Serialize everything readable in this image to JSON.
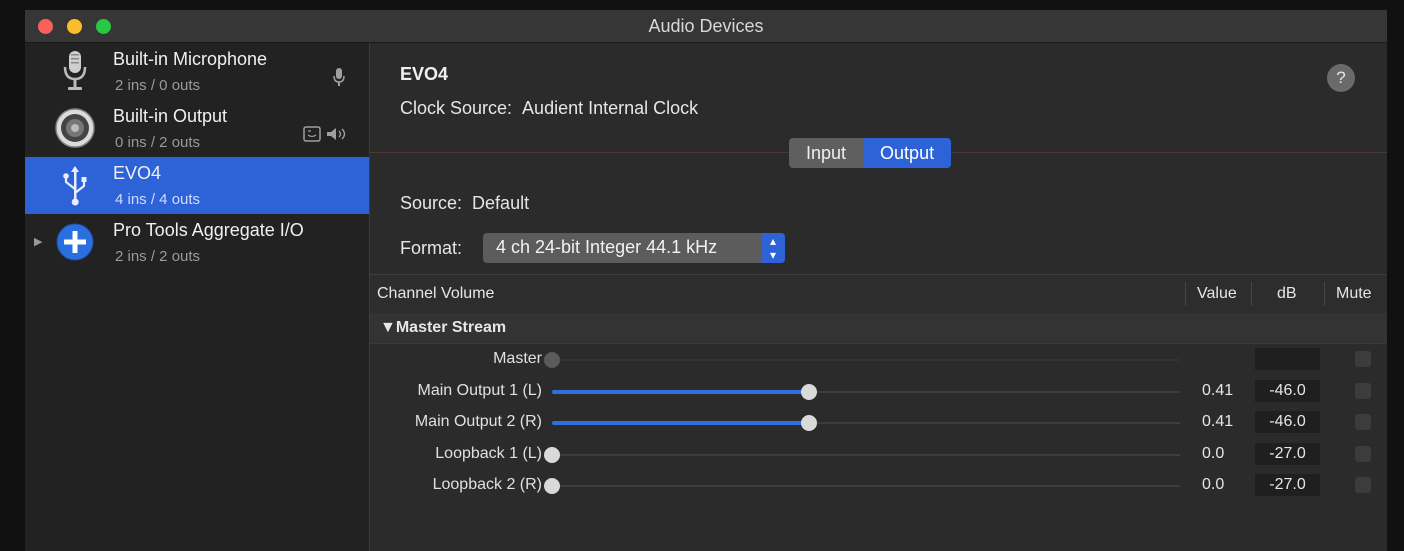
{
  "window": {
    "title": "Audio Devices"
  },
  "devices": [
    {
      "name": "Built-in Microphone",
      "io": "2 ins / 0 outs",
      "icon": "microphone-icon",
      "trailing": "mic-input-icon"
    },
    {
      "name": "Built-in Output",
      "io": "0 ins / 2 outs",
      "icon": "speaker-icon",
      "trailing": "finder-speaker-icons"
    },
    {
      "name": "EVO4",
      "io": "4 ins / 4 outs",
      "icon": "usb-icon",
      "selected": true
    },
    {
      "name": "Pro Tools Aggregate I/O",
      "io": "2 ins / 2 outs",
      "icon": "aggregate-plus-icon",
      "collapsed": true
    }
  ],
  "detail": {
    "device_name": "EVO4",
    "help": "?",
    "clock_label": "Clock Source:",
    "clock_value": "Audient Internal Clock",
    "tabs": {
      "input": "Input",
      "output": "Output",
      "active": "output"
    },
    "source_label": "Source:",
    "source_value": "Default",
    "format_label": "Format:",
    "format_value": "4 ch 24-bit Integer 44.1 kHz"
  },
  "table": {
    "headers": {
      "channel": "Channel Volume",
      "value": "Value",
      "db": "dB",
      "mute": "Mute"
    },
    "stream_label": "Master Stream",
    "rows": [
      {
        "label": "Master",
        "level": 0.0,
        "value": "",
        "db": "",
        "enabled": false
      },
      {
        "label": "Main Output 1 (L)",
        "level": 0.41,
        "value": "0.41",
        "db": "-46.0",
        "enabled": true
      },
      {
        "label": "Main Output 2 (R)",
        "level": 0.41,
        "value": "0.41",
        "db": "-46.0",
        "enabled": true
      },
      {
        "label": "Loopback 1 (L)",
        "level": 0.0,
        "value": "0.0",
        "db": "-27.0",
        "enabled": true
      },
      {
        "label": "Loopback 2 (R)",
        "level": 0.0,
        "value": "0.0",
        "db": "-27.0",
        "enabled": true
      }
    ]
  },
  "colors": {
    "accent": "#2e63d8",
    "selection": "#2e63d8"
  }
}
